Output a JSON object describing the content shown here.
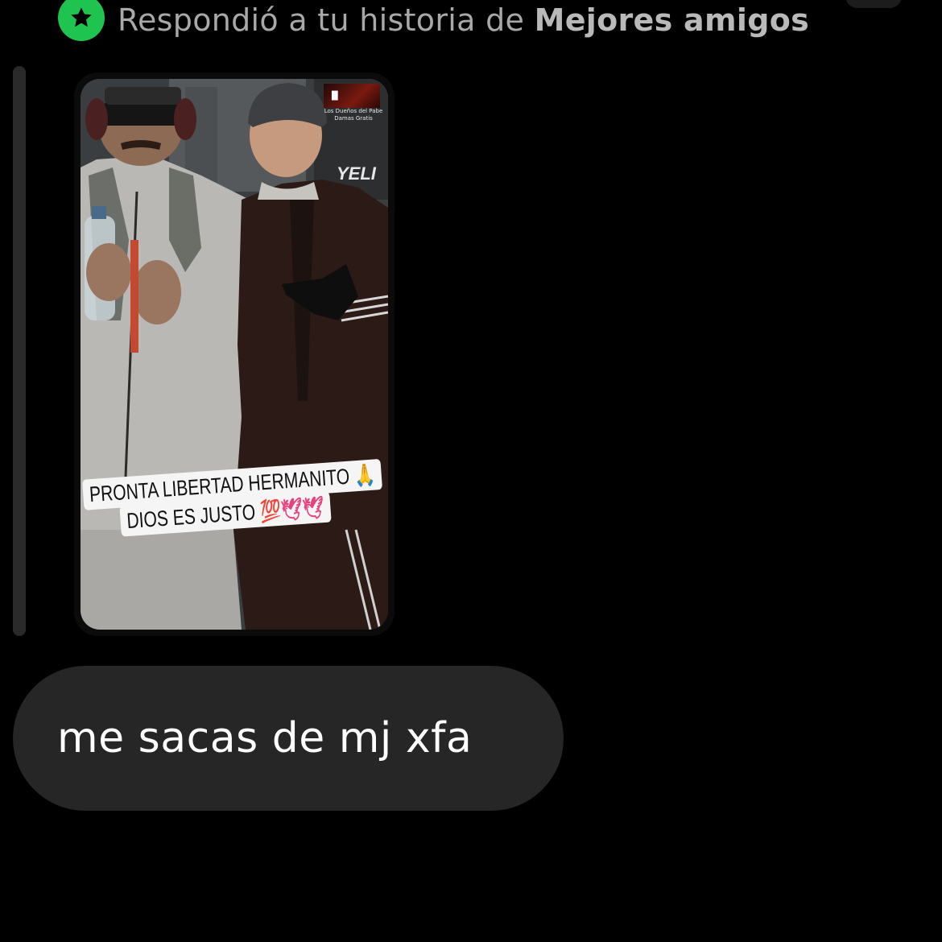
{
  "header": {
    "badge_icon": "star-icon",
    "badge_color": "#1fc34f",
    "text_prefix": "Respondió a tu historia de ",
    "text_bold": "Mejores amigos"
  },
  "story": {
    "music_title": "Los Dueños del Pabe",
    "music_artist": "Damas Gratis",
    "jacket_text": "YELI",
    "caption_line_1": "PRONTA LIBERTAD HERMANITO",
    "caption_line_1_emoji": "🙏",
    "caption_line_2": "DIOS ES JUSTO",
    "caption_line_2_emoji": "💯🕊🕊"
  },
  "message": {
    "text": "me sacas de mj xfa"
  },
  "colors": {
    "background": "#000000",
    "bubble": "#262626",
    "header_text": "#a8a8a8",
    "reply_bar": "#2a2a2a"
  }
}
